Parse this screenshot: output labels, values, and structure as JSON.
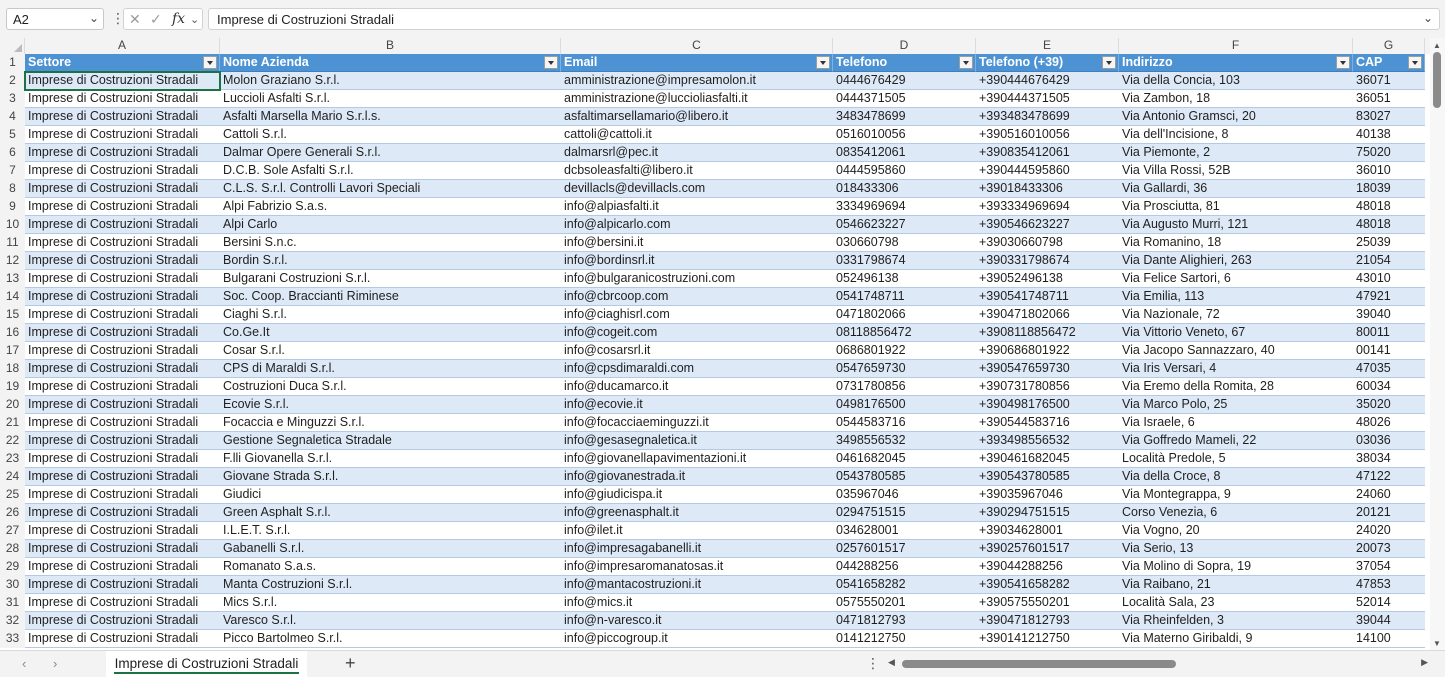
{
  "formula_bar": {
    "name_box": "A2",
    "formula": "Imprese di Costruzioni Stradali",
    "cancel_icon": "✕",
    "confirm_icon": "✓",
    "fx_icon": "fx"
  },
  "columns": [
    "A",
    "B",
    "C",
    "D",
    "E",
    "F",
    "G"
  ],
  "header_row": [
    "Settore",
    "Nome Azienda",
    "Email",
    "Telefono",
    "Telefono (+39)",
    "Indirizzo",
    "CAP"
  ],
  "row_numbers": [
    "1",
    "2",
    "3",
    "4",
    "5",
    "6",
    "7",
    "8",
    "9",
    "10",
    "11",
    "12",
    "13",
    "14",
    "15",
    "16",
    "17",
    "18",
    "19",
    "20",
    "21",
    "22",
    "23",
    "24",
    "25",
    "26",
    "27",
    "28",
    "29",
    "30",
    "31",
    "32",
    "33"
  ],
  "rows": [
    [
      "Imprese di Costruzioni Stradali",
      "Molon Graziano S.r.l.",
      "amministrazione@impresamolon.it",
      "0444676429",
      "+390444676429",
      "Via della Concia, 103",
      "36071"
    ],
    [
      "Imprese di Costruzioni Stradali",
      "Luccioli Asfalti S.r.l.",
      "amministrazione@luccioliasfalti.it",
      "0444371505",
      "+390444371505",
      "Via Zambon, 18",
      "36051"
    ],
    [
      "Imprese di Costruzioni Stradali",
      "Asfalti Marsella Mario S.r.l.s.",
      "asfaltimarsellamario@libero.it",
      "3483478699",
      "+393483478699",
      "Via Antonio Gramsci, 20",
      "83027"
    ],
    [
      "Imprese di Costruzioni Stradali",
      "Cattoli S.r.l.",
      "cattoli@cattoli.it",
      "0516010056",
      "+390516010056",
      "Via dell'Incisione, 8",
      "40138"
    ],
    [
      "Imprese di Costruzioni Stradali",
      "Dalmar Opere Generali S.r.l.",
      "dalmarsrl@pec.it",
      "0835412061",
      "+390835412061",
      "Via Piemonte, 2",
      "75020"
    ],
    [
      "Imprese di Costruzioni Stradali",
      "D.C.B. Sole Asfalti S.r.l.",
      "dcbsoleasfalti@libero.it",
      "0444595860",
      "+390444595860",
      "Via Villa Rossi, 52B",
      "36010"
    ],
    [
      "Imprese di Costruzioni Stradali",
      "C.L.S. S.r.l. Controlli Lavori Speciali",
      "devillacls@devillacls.com",
      "018433306",
      "+39018433306",
      "Via Gallardi, 36",
      "18039"
    ],
    [
      "Imprese di Costruzioni Stradali",
      "Alpi Fabrizio S.a.s.",
      "info@alpiasfalti.it",
      "3334969694",
      "+393334969694",
      "Via Prosciutta, 81",
      "48018"
    ],
    [
      "Imprese di Costruzioni Stradali",
      "Alpi Carlo",
      "info@alpicarlo.com",
      "0546623227",
      "+390546623227",
      "Via Augusto Murri, 121",
      "48018"
    ],
    [
      "Imprese di Costruzioni Stradali",
      "Bersini S.n.c.",
      "info@bersini.it",
      "030660798",
      "+39030660798",
      "Via Romanino, 18",
      "25039"
    ],
    [
      "Imprese di Costruzioni Stradali",
      "Bordin S.r.l.",
      "info@bordinsrl.it",
      "0331798674",
      "+390331798674",
      "Via Dante Alighieri, 263",
      "21054"
    ],
    [
      "Imprese di Costruzioni Stradali",
      "Bulgarani Costruzioni S.r.l.",
      "info@bulgaranicostruzioni.com",
      "052496138",
      "+39052496138",
      "Via Felice Sartori, 6",
      "43010"
    ],
    [
      "Imprese di Costruzioni Stradali",
      "Soc. Coop. Braccianti Riminese",
      "info@cbrcoop.com",
      "0541748711",
      "+390541748711",
      "Via Emilia, 113",
      "47921"
    ],
    [
      "Imprese di Costruzioni Stradali",
      "Ciaghi S.r.l.",
      "info@ciaghisrl.com",
      "0471802066",
      "+390471802066",
      "Via Nazionale, 72",
      "39040"
    ],
    [
      "Imprese di Costruzioni Stradali",
      "Co.Ge.It",
      "info@cogeit.com",
      "08118856472",
      "+3908118856472",
      "Via Vittorio Veneto, 67",
      "80011"
    ],
    [
      "Imprese di Costruzioni Stradali",
      "Cosar S.r.l.",
      "info@cosarsrl.it",
      "0686801922",
      "+390686801922",
      "Via Jacopo Sannazzaro, 40",
      "00141"
    ],
    [
      "Imprese di Costruzioni Stradali",
      "CPS di Maraldi S.r.l.",
      "info@cpsdimaraldi.com",
      "0547659730",
      "+390547659730",
      "Via Iris Versari, 4",
      "47035"
    ],
    [
      "Imprese di Costruzioni Stradali",
      "Costruzioni Duca S.r.l.",
      "info@ducamarco.it",
      "0731780856",
      "+390731780856",
      "Via Eremo della Romita, 28",
      "60034"
    ],
    [
      "Imprese di Costruzioni Stradali",
      "Ecovie S.r.l.",
      "info@ecovie.it",
      "0498176500",
      "+390498176500",
      "Via Marco Polo, 25",
      "35020"
    ],
    [
      "Imprese di Costruzioni Stradali",
      "Focaccia e Minguzzi S.r.l.",
      "info@focacciaeminguzzi.it",
      "0544583716",
      "+390544583716",
      "Via Israele, 6",
      "48026"
    ],
    [
      "Imprese di Costruzioni Stradali",
      "Gestione Segnaletica Stradale",
      "info@gesasegnaletica.it",
      "3498556532",
      "+393498556532",
      "Via Goffredo Mameli, 22",
      "03036"
    ],
    [
      "Imprese di Costruzioni Stradali",
      "F.lli Giovanella S.r.l.",
      "info@giovanellapavimentazioni.it",
      "0461682045",
      "+390461682045",
      "Località Predole, 5",
      "38034"
    ],
    [
      "Imprese di Costruzioni Stradali",
      "Giovane Strada S.r.l.",
      "info@giovanestrada.it",
      "0543780585",
      "+390543780585",
      "Via della Croce, 8",
      "47122"
    ],
    [
      "Imprese di Costruzioni Stradali",
      "Giudici",
      "info@giudicispa.it",
      "035967046",
      "+39035967046",
      "Via Montegrappa, 9",
      "24060"
    ],
    [
      "Imprese di Costruzioni Stradali",
      "Green Asphalt S.r.l.",
      "info@greenasphalt.it",
      "0294751515",
      "+390294751515",
      "Corso Venezia, 6",
      "20121"
    ],
    [
      "Imprese di Costruzioni Stradali",
      "I.L.E.T. S.r.l.",
      "info@ilet.it",
      "034628001",
      "+39034628001",
      "Via Vogno, 20",
      "24020"
    ],
    [
      "Imprese di Costruzioni Stradali",
      "Gabanelli S.r.l.",
      "info@impresagabanelli.it",
      "0257601517",
      "+390257601517",
      "Via Serio, 13",
      "20073"
    ],
    [
      "Imprese di Costruzioni Stradali",
      "Romanato S.a.s.",
      "info@impresaromanatosas.it",
      "044288256",
      "+39044288256",
      "Via Molino di Sopra, 19",
      "37054"
    ],
    [
      "Imprese di Costruzioni Stradali",
      "Manta Costruzioni S.r.l.",
      "info@mantacostruzioni.it",
      "0541658282",
      "+390541658282",
      "Via Raibano, 21",
      "47853"
    ],
    [
      "Imprese di Costruzioni Stradali",
      "Mics S.r.l.",
      "info@mics.it",
      "0575550201",
      "+390575550201",
      "Località Sala, 23",
      "52014"
    ],
    [
      "Imprese di Costruzioni Stradali",
      "Varesco S.r.l.",
      "info@n-varesco.it",
      "0471812793",
      "+390471812793",
      "Via Rheinfelden, 3",
      "39044"
    ],
    [
      "Imprese di Costruzioni Stradali",
      "Picco Bartolmeo S.r.l.",
      "info@piccogroup.it",
      "0141212750",
      "+390141212750",
      "Via Materno Giribaldi, 9",
      "14100"
    ]
  ],
  "sheet_tab": "Imprese di Costruzioni Stradali",
  "add_sheet": "+",
  "colors": {
    "header": "#4d92d3",
    "band": "#dde9f6",
    "selection": "#1e7145"
  }
}
